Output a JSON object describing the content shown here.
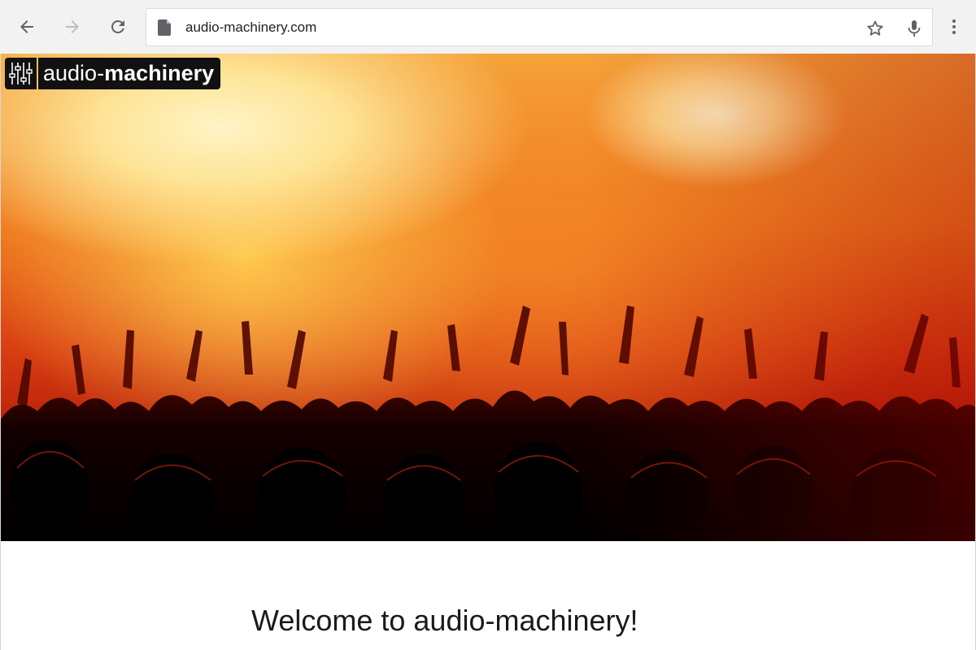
{
  "browser": {
    "url": "audio-machinery.com",
    "buttons": {
      "back": "back-arrow-icon",
      "forward": "forward-arrow-icon",
      "reload": "reload-icon",
      "bookmark": "star-icon",
      "voice": "microphone-icon",
      "menu": "kebab-menu-icon"
    }
  },
  "site": {
    "logo": {
      "light": "audio-",
      "bold": "machinery"
    },
    "hero_image": "concert-crowd-silhouette",
    "welcome_heading": "Welcome to audio-machinery!"
  },
  "colors": {
    "toolbar_bg": "#f2f2f2",
    "logo_bg": "#111111",
    "hero_orange": "#ef7a1f",
    "hero_red": "#b41a08"
  }
}
